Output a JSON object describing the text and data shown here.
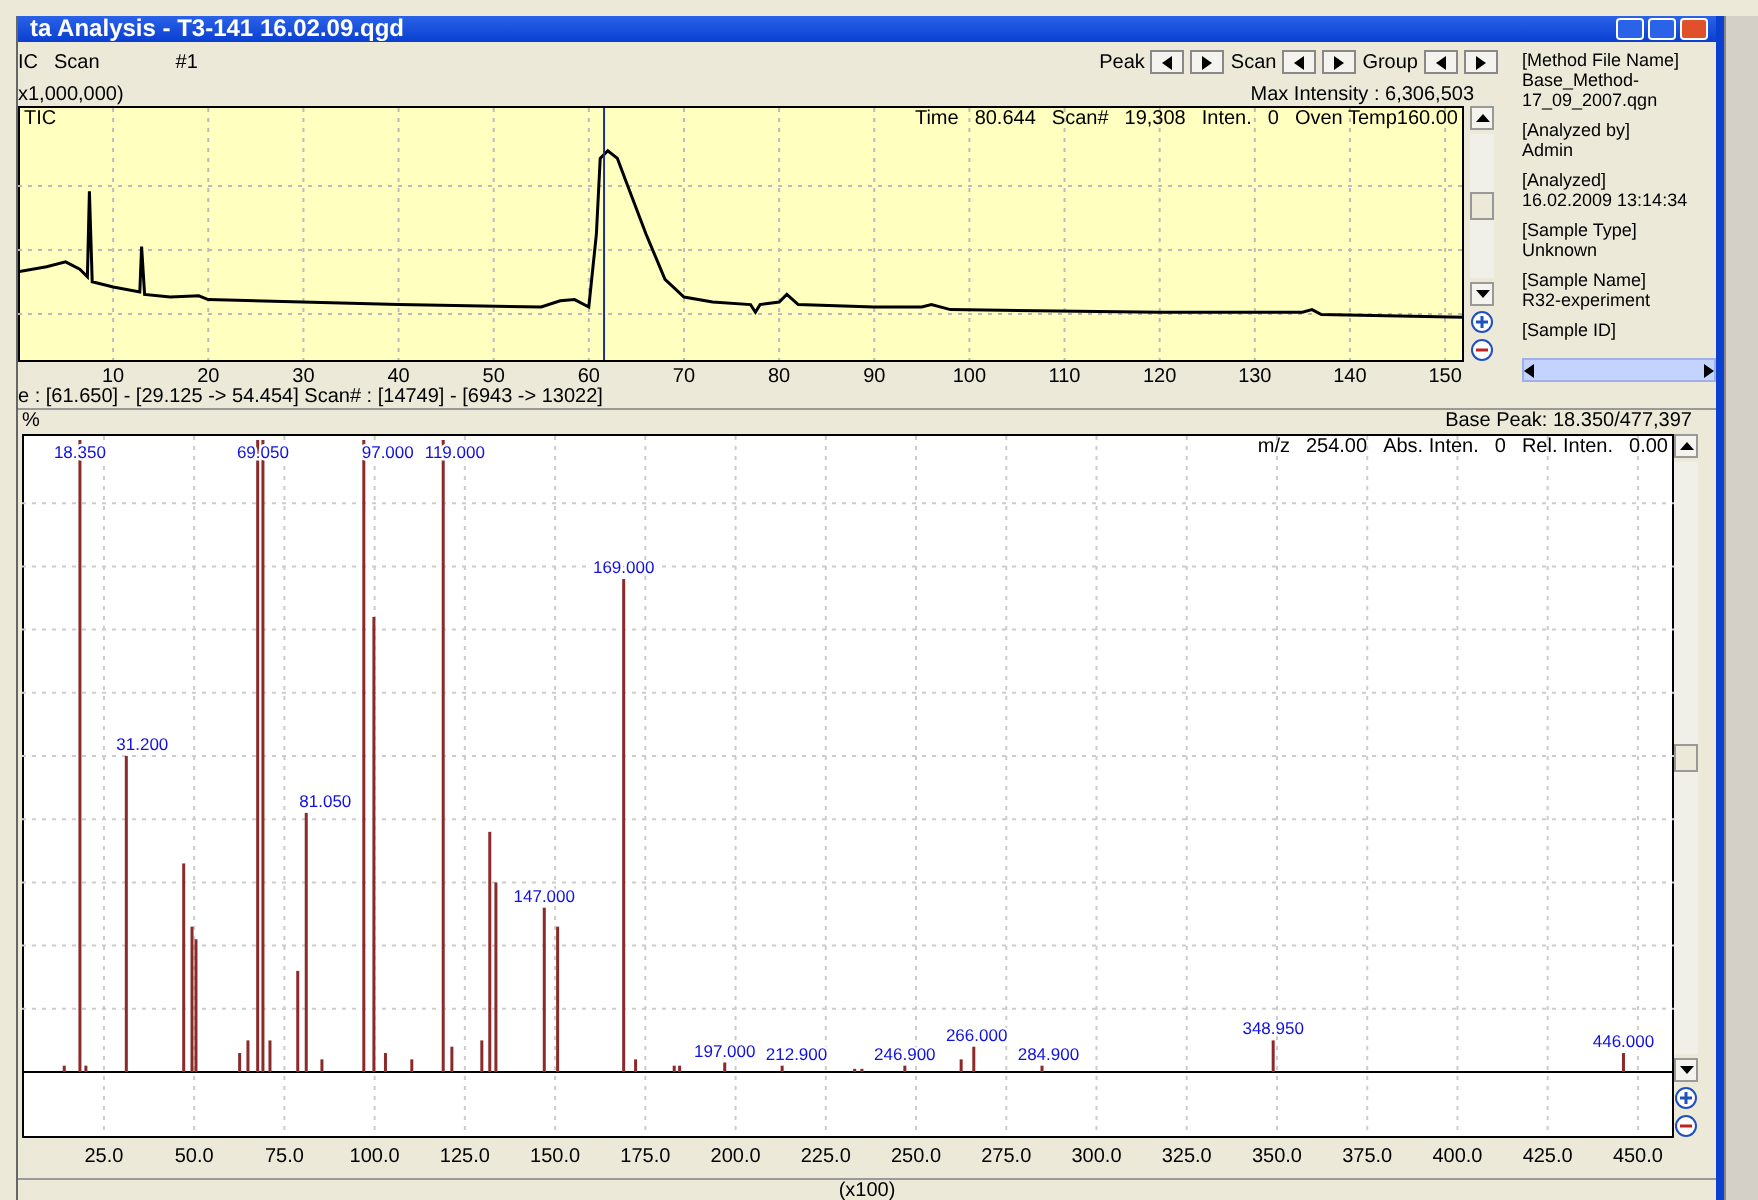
{
  "window": {
    "title": "ta Analysis - T3-141 16.02.09.qgd"
  },
  "header_left": [
    "IC",
    "Scan",
    "#1"
  ],
  "navigation": [
    {
      "label": "Peak"
    },
    {
      "label": "Scan"
    },
    {
      "label": "Group"
    }
  ],
  "chromatogram": {
    "scale": "x1,000,000)",
    "max_intensity": "Max Intensity : 6,306,503",
    "trace": "TIC",
    "readout": [
      "Time",
      "80.644",
      "Scan#",
      "19,308",
      "Inten.",
      "0",
      "Oven Temp160.00"
    ],
    "x_tick_labels": [
      "10",
      "20",
      "30",
      "40",
      "50",
      "60",
      "70",
      "80",
      "90",
      "100",
      "110",
      "120",
      "130",
      "140",
      "150"
    ]
  },
  "range_info": "e : [61.650] - [29.125 -> 54.454]   Scan# : [14749] - [6943 -> 13022]",
  "info_panel": [
    {
      "label": "[Method File Name]",
      "value": "Base_Method-17_09_2007.qgn"
    },
    {
      "label": "[Analyzed by]",
      "value": "Admin"
    },
    {
      "label": "[Analyzed]",
      "value": "16.02.2009 13:14:34"
    },
    {
      "label": "[Sample Type]",
      "value": "Unknown"
    },
    {
      "label": "[Sample Name]",
      "value": "R32-experiment"
    },
    {
      "label": "[Sample ID]"
    }
  ],
  "spectrum": {
    "y_unit": "%",
    "base_peak": "Base Peak: 18.350/477,397",
    "readout": [
      "m/z",
      "254.00",
      "Abs. Inten.",
      "0",
      "Rel. Inten.",
      "0.00"
    ],
    "axis_unit": "(x100)",
    "x_tick_labels": [
      "25.0",
      "50.0",
      "75.0",
      "100.0",
      "125.0",
      "150.0",
      "175.0",
      "200.0",
      "225.0",
      "250.0",
      "275.0",
      "300.0",
      "325.0",
      "350.0",
      "375.0",
      "400.0",
      "425.0",
      "450.0"
    ],
    "peak_labels": [
      "18.350",
      "31.200",
      "69.050",
      "81.050",
      "97.000",
      "119.000",
      "147.000",
      "169.000",
      "197.000",
      "212.900",
      "246.900",
      "266.000",
      "284.900",
      "348.950",
      "446.000"
    ]
  }
}
